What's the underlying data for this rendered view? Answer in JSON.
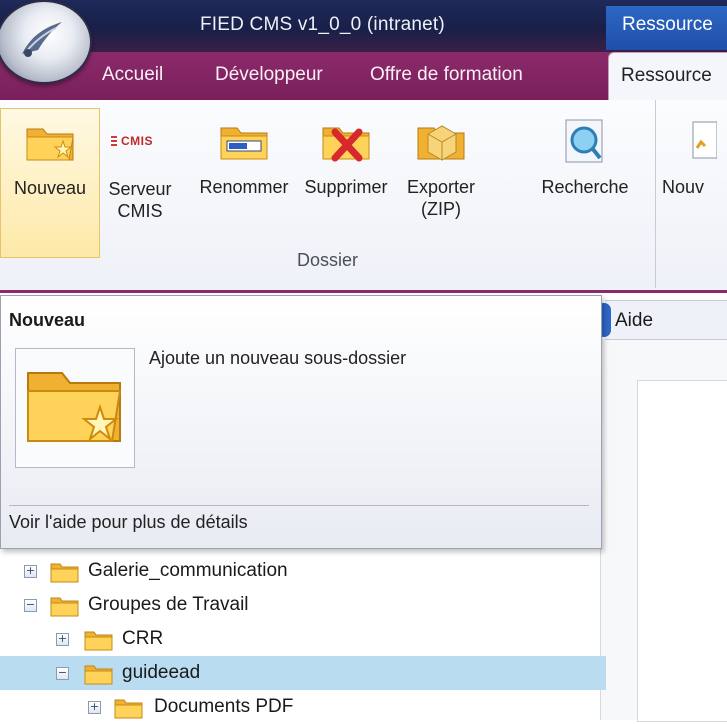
{
  "window": {
    "title": "FIED CMS v1_0_0 (intranet)",
    "context_tab": "Ressource"
  },
  "tabs": [
    {
      "label": "Accueil"
    },
    {
      "label": "Développeur"
    },
    {
      "label": "Offre de formation"
    },
    {
      "label": "Ressource"
    }
  ],
  "ribbon": {
    "group_label": "Dossier",
    "buttons": [
      {
        "label": "Nouveau",
        "icon": "new-folder-icon"
      },
      {
        "label": "Serveur CMIS",
        "icon": "cmis-icon",
        "badge": "CMIS"
      },
      {
        "label": "Renommer",
        "icon": "rename-folder-icon"
      },
      {
        "label": "Supprimer",
        "icon": "delete-folder-icon"
      },
      {
        "label": "Exporter (ZIP)",
        "icon": "export-zip-icon"
      },
      {
        "label": "Recherche",
        "icon": "search-icon"
      }
    ],
    "next_group_button": "Nouv"
  },
  "tooltip": {
    "title": "Nouveau",
    "description": "Ajoute un nouveau sous-dossier",
    "footer": "Voir l'aide pour plus de détails"
  },
  "side_tab": {
    "label": "Aide"
  },
  "tree": [
    {
      "label": "Galerie_communication",
      "expander": "+"
    },
    {
      "label": "Groupes de Travail",
      "expander": "−"
    },
    {
      "label": "CRR",
      "expander": "+"
    },
    {
      "label": "guideead",
      "expander": "−",
      "selected": true
    },
    {
      "label": "Documents PDF",
      "expander": "+"
    }
  ],
  "colors": {
    "titlebar": "#1f2a5a",
    "tabbar": "#8b2a6a",
    "selection": "#b9dcf1",
    "context_tab": "#2d67c6"
  }
}
